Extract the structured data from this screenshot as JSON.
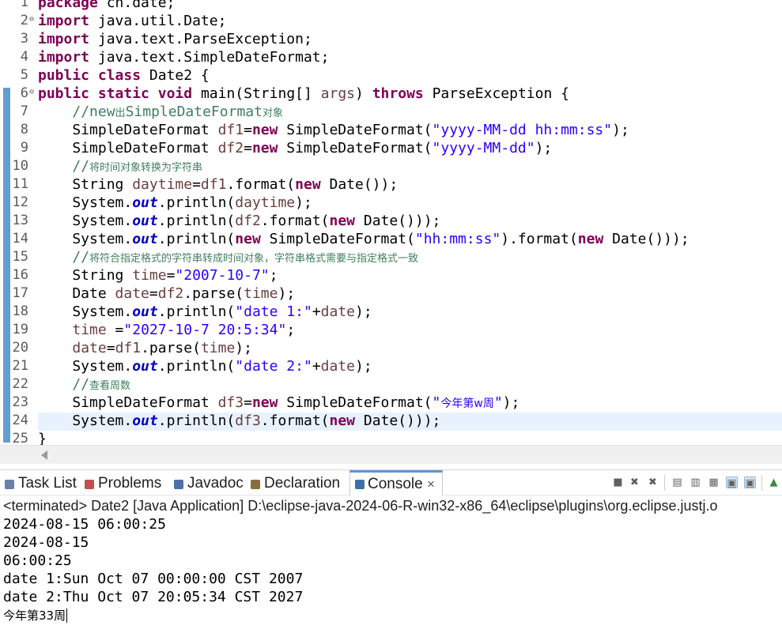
{
  "editor": {
    "lines": [
      {
        "n": "1",
        "fold": "",
        "tokens": [
          {
            "c": "k",
            "t": "package"
          },
          {
            "c": "",
            "t": " cn.date;"
          }
        ]
      },
      {
        "n": "2",
        "fold": "⊖",
        "tokens": [
          {
            "c": "k",
            "t": "import"
          },
          {
            "c": "",
            "t": " java.util.Date;"
          }
        ]
      },
      {
        "n": "3",
        "fold": "",
        "tokens": [
          {
            "c": "k",
            "t": "import"
          },
          {
            "c": "",
            "t": " java.text.ParseException;"
          }
        ]
      },
      {
        "n": "4",
        "fold": "",
        "tokens": [
          {
            "c": "k",
            "t": "import"
          },
          {
            "c": "",
            "t": " java.text.SimpleDateFormat;"
          }
        ]
      },
      {
        "n": "5",
        "fold": "",
        "tokens": [
          {
            "c": "k",
            "t": "public"
          },
          {
            "c": "",
            "t": " "
          },
          {
            "c": "k",
            "t": "class"
          },
          {
            "c": "",
            "t": " Date2 {"
          }
        ]
      },
      {
        "n": "6",
        "fold": "⊖",
        "tokens": [
          {
            "c": "k",
            "t": "public"
          },
          {
            "c": "",
            "t": " "
          },
          {
            "c": "k",
            "t": "static"
          },
          {
            "c": "",
            "t": " "
          },
          {
            "c": "k",
            "t": "void"
          },
          {
            "c": "",
            "t": " main(String[] "
          },
          {
            "c": "v",
            "t": "args"
          },
          {
            "c": "",
            "t": ") "
          },
          {
            "c": "k",
            "t": "throws"
          },
          {
            "c": "",
            "t": " ParseException {"
          }
        ]
      },
      {
        "n": "7",
        "fold": "",
        "tokens": [
          {
            "c": "",
            "t": "    "
          },
          {
            "c": "c",
            "t": "//new"
          },
          {
            "c": "c c-zh",
            "t": "出"
          },
          {
            "c": "c",
            "t": "SimpleDateFormat"
          },
          {
            "c": "c c-zh",
            "t": "对象"
          }
        ]
      },
      {
        "n": "8",
        "fold": "",
        "tokens": [
          {
            "c": "",
            "t": "    SimpleDateFormat "
          },
          {
            "c": "v",
            "t": "df1"
          },
          {
            "c": "",
            "t": "="
          },
          {
            "c": "k",
            "t": "new"
          },
          {
            "c": "",
            "t": " SimpleDateFormat("
          },
          {
            "c": "s",
            "t": "\"yyyy-MM-dd hh:mm:ss\""
          },
          {
            "c": "",
            "t": ");"
          }
        ]
      },
      {
        "n": "9",
        "fold": "",
        "tokens": [
          {
            "c": "",
            "t": "    SimpleDateFormat "
          },
          {
            "c": "v",
            "t": "df2"
          },
          {
            "c": "",
            "t": "="
          },
          {
            "c": "k",
            "t": "new"
          },
          {
            "c": "",
            "t": " SimpleDateFormat("
          },
          {
            "c": "s",
            "t": "\"yyyy-MM-dd\""
          },
          {
            "c": "",
            "t": ");"
          }
        ]
      },
      {
        "n": "10",
        "fold": "",
        "tokens": [
          {
            "c": "",
            "t": "    "
          },
          {
            "c": "c",
            "t": "//"
          },
          {
            "c": "c c-zh",
            "t": "将时间对象转换为字符串"
          }
        ]
      },
      {
        "n": "11",
        "fold": "",
        "tokens": [
          {
            "c": "",
            "t": "    String "
          },
          {
            "c": "v",
            "t": "daytime"
          },
          {
            "c": "",
            "t": "="
          },
          {
            "c": "v",
            "t": "df1"
          },
          {
            "c": "",
            "t": ".format("
          },
          {
            "c": "k",
            "t": "new"
          },
          {
            "c": "",
            "t": " Date());"
          }
        ]
      },
      {
        "n": "12",
        "fold": "",
        "tokens": [
          {
            "c": "",
            "t": "    System."
          },
          {
            "c": "f",
            "t": "out"
          },
          {
            "c": "",
            "t": ".println("
          },
          {
            "c": "v",
            "t": "daytime"
          },
          {
            "c": "",
            "t": ");"
          }
        ]
      },
      {
        "n": "13",
        "fold": "",
        "tokens": [
          {
            "c": "",
            "t": "    System."
          },
          {
            "c": "f",
            "t": "out"
          },
          {
            "c": "",
            "t": ".println("
          },
          {
            "c": "v",
            "t": "df2"
          },
          {
            "c": "",
            "t": ".format("
          },
          {
            "c": "k",
            "t": "new"
          },
          {
            "c": "",
            "t": " Date()));"
          }
        ]
      },
      {
        "n": "14",
        "fold": "",
        "tokens": [
          {
            "c": "",
            "t": "    System."
          },
          {
            "c": "f",
            "t": "out"
          },
          {
            "c": "",
            "t": ".println("
          },
          {
            "c": "k",
            "t": "new"
          },
          {
            "c": "",
            "t": " SimpleDateFormat("
          },
          {
            "c": "s",
            "t": "\"hh:mm:ss\""
          },
          {
            "c": "",
            "t": ").format("
          },
          {
            "c": "k",
            "t": "new"
          },
          {
            "c": "",
            "t": " Date()));"
          }
        ]
      },
      {
        "n": "15",
        "fold": "",
        "tokens": [
          {
            "c": "",
            "t": "    "
          },
          {
            "c": "c",
            "t": "//"
          },
          {
            "c": "c c-zh",
            "t": "将符合指定格式的字符串转成时间对象，字符串格式需要与指定格式一致"
          }
        ]
      },
      {
        "n": "16",
        "fold": "",
        "tokens": [
          {
            "c": "",
            "t": "    String "
          },
          {
            "c": "v",
            "t": "time"
          },
          {
            "c": "",
            "t": "="
          },
          {
            "c": "s",
            "t": "\"2007-10-7\""
          },
          {
            "c": "",
            "t": ";"
          }
        ]
      },
      {
        "n": "17",
        "fold": "",
        "tokens": [
          {
            "c": "",
            "t": "    Date "
          },
          {
            "c": "v",
            "t": "date"
          },
          {
            "c": "",
            "t": "="
          },
          {
            "c": "v",
            "t": "df2"
          },
          {
            "c": "",
            "t": ".parse("
          },
          {
            "c": "v",
            "t": "time"
          },
          {
            "c": "",
            "t": ");"
          }
        ]
      },
      {
        "n": "18",
        "fold": "",
        "tokens": [
          {
            "c": "",
            "t": "    System."
          },
          {
            "c": "f",
            "t": "out"
          },
          {
            "c": "",
            "t": ".println("
          },
          {
            "c": "s",
            "t": "\"date 1:\""
          },
          {
            "c": "",
            "t": "+"
          },
          {
            "c": "v",
            "t": "date"
          },
          {
            "c": "",
            "t": ");"
          }
        ]
      },
      {
        "n": "19",
        "fold": "",
        "tokens": [
          {
            "c": "",
            "t": "    "
          },
          {
            "c": "v",
            "t": "time"
          },
          {
            "c": "",
            "t": " ="
          },
          {
            "c": "s",
            "t": "\"2027-10-7 20:5:34\""
          },
          {
            "c": "",
            "t": ";"
          }
        ]
      },
      {
        "n": "20",
        "fold": "",
        "tokens": [
          {
            "c": "",
            "t": "    "
          },
          {
            "c": "v",
            "t": "date"
          },
          {
            "c": "",
            "t": "="
          },
          {
            "c": "v",
            "t": "df1"
          },
          {
            "c": "",
            "t": ".parse("
          },
          {
            "c": "v",
            "t": "time"
          },
          {
            "c": "",
            "t": ");"
          }
        ]
      },
      {
        "n": "21",
        "fold": "",
        "tokens": [
          {
            "c": "",
            "t": "    System."
          },
          {
            "c": "f",
            "t": "out"
          },
          {
            "c": "",
            "t": ".println("
          },
          {
            "c": "s",
            "t": "\"date 2:\""
          },
          {
            "c": "",
            "t": "+"
          },
          {
            "c": "v",
            "t": "date"
          },
          {
            "c": "",
            "t": ");"
          }
        ]
      },
      {
        "n": "22",
        "fold": "",
        "tokens": [
          {
            "c": "",
            "t": "    "
          },
          {
            "c": "c",
            "t": "//"
          },
          {
            "c": "c c-zh",
            "t": "查看周数"
          }
        ]
      },
      {
        "n": "23",
        "fold": "",
        "tokens": [
          {
            "c": "",
            "t": "    SimpleDateFormat "
          },
          {
            "c": "v",
            "t": "df3"
          },
          {
            "c": "",
            "t": "="
          },
          {
            "c": "k",
            "t": "new"
          },
          {
            "c": "",
            "t": " SimpleDateFormat("
          },
          {
            "c": "s",
            "t": "\""
          },
          {
            "c": "s s-zh",
            "t": "今年第w周"
          },
          {
            "c": "s",
            "t": "\""
          },
          {
            "c": "",
            "t": ");"
          }
        ]
      },
      {
        "n": "24",
        "fold": "",
        "tokens": [
          {
            "c": "",
            "t": "    System."
          },
          {
            "c": "f",
            "t": "out"
          },
          {
            "c": "",
            "t": ".println("
          },
          {
            "c": "v",
            "t": "df3"
          },
          {
            "c": "",
            "t": ".format("
          },
          {
            "c": "k",
            "t": "new"
          },
          {
            "c": "",
            "t": " Date()));"
          }
        ]
      },
      {
        "n": "25",
        "fold": "",
        "tokens": [
          {
            "c": "",
            "t": "}"
          }
        ]
      }
    ]
  },
  "views": {
    "tabs": [
      {
        "label": "Task List",
        "icon": "task-list-icon",
        "color": "#6b7fa8"
      },
      {
        "label": "Problems",
        "icon": "problems-icon",
        "color": "#c0504d"
      },
      {
        "label": "Javadoc",
        "icon": "javadoc-icon",
        "color": "#4f6fa8"
      },
      {
        "label": "Declaration",
        "icon": "declaration-icon",
        "color": "#8a6d3b"
      },
      {
        "label": "Console",
        "icon": "console-icon",
        "color": "#3f6fa8",
        "close": "×"
      }
    ],
    "toolbar": [
      {
        "name": "terminate-icon",
        "glyph": "■"
      },
      {
        "name": "remove-launch-icon",
        "glyph": "✖"
      },
      {
        "name": "remove-all-terminated-icon",
        "glyph": "✖"
      },
      {
        "name": "clear-console-icon",
        "glyph": "▤"
      },
      {
        "name": "scroll-lock-icon",
        "glyph": "▥"
      },
      {
        "name": "word-wrap-icon",
        "glyph": "▦"
      },
      {
        "name": "show-on-output-icon",
        "glyph": "▣"
      },
      {
        "name": "show-on-error-icon",
        "glyph": "▣"
      },
      {
        "name": "pin-console-icon",
        "glyph": "▲"
      }
    ]
  },
  "console": {
    "header": "<terminated> Date2 [Java Application] D:\\eclipse-java-2024-06-R-win32-x86_64\\eclipse\\plugins\\org.eclipse.justj.o",
    "output": [
      "2024-08-15 06:00:25",
      "2024-08-15",
      "06:00:25",
      "date 1:Sun Oct 07 00:00:00 CST 2007",
      "date 2:Thu Oct 07 20:05:34 CST 2027"
    ],
    "last_line": "今年第33周"
  }
}
